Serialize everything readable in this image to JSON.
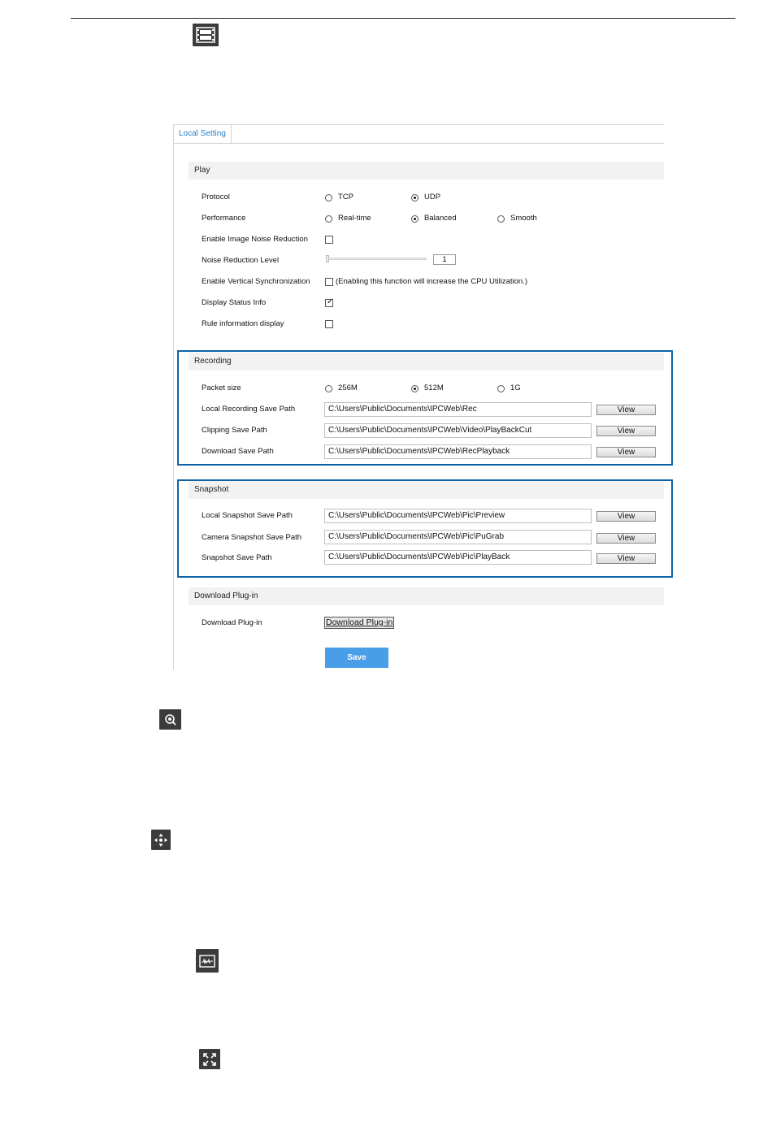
{
  "tab": {
    "label": "Local Setting"
  },
  "play": {
    "title": "Play",
    "protocol": {
      "label": "Protocol",
      "options": [
        "TCP",
        "UDP"
      ],
      "selected": "UDP"
    },
    "performance": {
      "label": "Performance",
      "options": [
        "Real-time",
        "Balanced",
        "Smooth"
      ],
      "selected": "Balanced"
    },
    "noise_reduction": {
      "label": "Enable Image Noise Reduction",
      "checked": false
    },
    "noise_level": {
      "label": "Noise Reduction Level",
      "value": "1"
    },
    "vsync": {
      "label": "Enable Vertical Synchronization",
      "checked": false,
      "note": "(Enabling this function will increase the CPU Utilization.)"
    },
    "status_info": {
      "label": "Display Status Info",
      "checked": true
    },
    "rule_info": {
      "label": "Rule information display",
      "checked": false
    }
  },
  "recording": {
    "title": "Recording",
    "packet_size": {
      "label": "Packet size",
      "options": [
        "256M",
        "512M",
        "1G"
      ],
      "selected": "512M"
    },
    "local_path": {
      "label": "Local Recording Save Path",
      "value": "C:\\Users\\Public\\Documents\\IPCWeb\\Rec"
    },
    "clip_path": {
      "label": "Clipping Save Path",
      "value": "C:\\Users\\Public\\Documents\\IPCWeb\\Video\\PlayBackCut"
    },
    "download_path": {
      "label": "Download Save Path",
      "value": "C:\\Users\\Public\\Documents\\IPCWeb\\RecPlayback"
    }
  },
  "snapshot": {
    "title": "Snapshot",
    "local_path": {
      "label": "Local Snapshot Save Path",
      "value": "C:\\Users\\Public\\Documents\\IPCWeb\\Pic\\Preview"
    },
    "camera_path": {
      "label": "Camera Snapshot Save Path",
      "value": "C:\\Users\\Public\\Documents\\IPCWeb\\Pic\\PuGrab"
    },
    "snap_path": {
      "label": "Snapshot Save Path",
      "value": "C:\\Users\\Public\\Documents\\IPCWeb\\Pic\\PlayBack"
    }
  },
  "plugin": {
    "title": "Download Plug-in",
    "label": "Download Plug-in",
    "button": "Download Plug-in"
  },
  "buttons": {
    "view": "View",
    "save": "Save"
  },
  "icons": [
    "film-icon",
    "zoom-icon",
    "ptz-move-icon",
    "waveform-icon",
    "fullscreen-icon"
  ],
  "colors": {
    "accent": "#4a9ee8",
    "highlight_border": "#0e63a8",
    "tab_text": "#2a7fc9"
  }
}
